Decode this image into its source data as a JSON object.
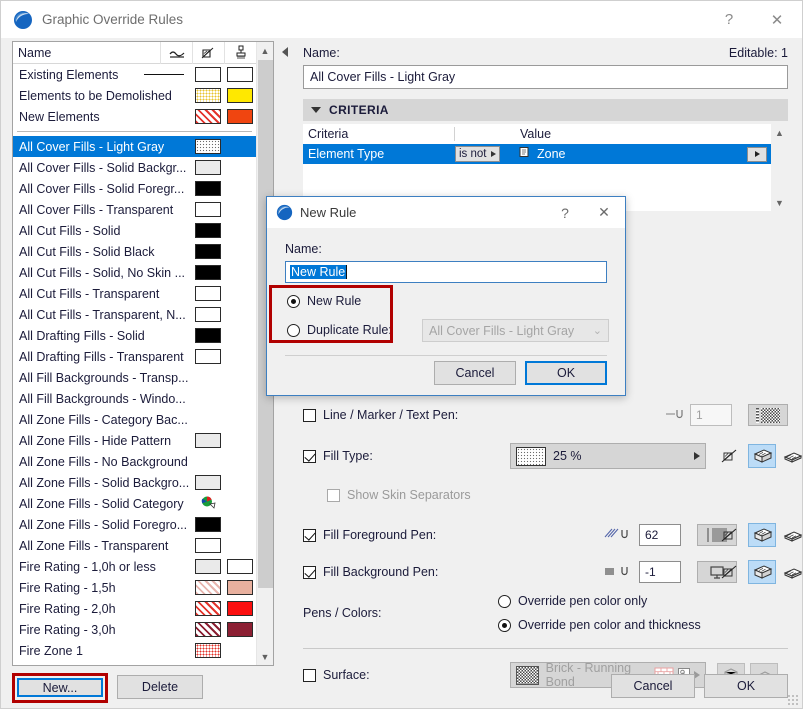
{
  "window": {
    "title": "Graphic Override Rules",
    "help_label": "?",
    "close_label": "✕"
  },
  "left_panel": {
    "columns": {
      "name": "Name",
      "icon_line": "line-style-icon",
      "icon_fill": "fill-override-icon",
      "icon_surface": "surface-brush-icon"
    },
    "top_items": [
      {
        "label": "Existing Elements",
        "swatch_line": true,
        "sw1": "white",
        "sw2": "white"
      },
      {
        "label": "Elements to be Demolished",
        "sw1": "dots-yellow",
        "sw2": "#ffe800"
      },
      {
        "label": "New Elements",
        "sw1": "hatch-red",
        "sw2": "#f04510"
      }
    ],
    "items": [
      {
        "label": "All Cover Fills - Light Gray",
        "selected": true,
        "sw1": "dots-gray"
      },
      {
        "label": "All Cover Fills - Solid Backgr...",
        "sw1": "#eaeaea"
      },
      {
        "label": "All Cover Fills - Solid Foregr...",
        "sw1": "#000000"
      },
      {
        "label": "All Cover Fills - Transparent",
        "sw1": "#ffffff"
      },
      {
        "label": "All Cut Fills - Solid",
        "sw1": "#000000"
      },
      {
        "label": "All Cut Fills - Solid Black",
        "sw1": "#000000"
      },
      {
        "label": "All Cut Fills - Solid, No Skin ...",
        "sw1": "#000000"
      },
      {
        "label": "All Cut Fills - Transparent",
        "sw1": "#ffffff"
      },
      {
        "label": "All Cut Fills - Transparent, N...",
        "sw1": "#ffffff"
      },
      {
        "label": "All Drafting Fills - Solid",
        "sw1": "#000000"
      },
      {
        "label": "All Drafting Fills - Transparent",
        "sw1": "#ffffff"
      },
      {
        "label": "All Fill Backgrounds - Transp...",
        "sw1": "none"
      },
      {
        "label": "All Fill Backgrounds - Windo...",
        "sw1": "none"
      },
      {
        "label": "All Zone Fills - Category Bac...",
        "sw1": "none"
      },
      {
        "label": "All Zone Fills - Hide Pattern",
        "sw1": "#eaeaea"
      },
      {
        "label": "All Zone Fills - No Background",
        "sw1": "none"
      },
      {
        "label": "All Zone Fills - Solid Backgro...",
        "sw1": "#eaeaea"
      },
      {
        "label": "All Zone Fills - Solid Category",
        "sw1": "category-icon"
      },
      {
        "label": "All Zone Fills - Solid Foregro...",
        "sw1": "#000000"
      },
      {
        "label": "All Zone Fills - Transparent",
        "sw1": "#ffffff"
      },
      {
        "label": "Fire Rating - 1,0h or less",
        "sw1": "#eaeaea",
        "sw2": "#ffffff"
      },
      {
        "label": "Fire Rating - 1,5h",
        "sw1": "hatch-pink",
        "sw2": "#e8b09e"
      },
      {
        "label": "Fire Rating - 2,0h",
        "sw1": "hatch-red",
        "sw2": "#fb0f0f"
      },
      {
        "label": "Fire Rating - 3,0h",
        "sw1": "hatch-dark",
        "sw2": "#8c1f33"
      },
      {
        "label": "Fire Zone 1",
        "sw1": "dots-red"
      }
    ],
    "buttons": {
      "new": "New...",
      "delete": "Delete"
    }
  },
  "right_panel": {
    "name_label": "Name:",
    "editable_label": "Editable: 1",
    "name_value": "All Cover Fills - Light Gray",
    "criteria_section": "CRITERIA",
    "criteria_table": {
      "headers": [
        "Criteria",
        "",
        "Value"
      ],
      "rows": [
        {
          "criteria": "Element Type",
          "operator": "is not",
          "value": "Zone"
        }
      ]
    },
    "options": {
      "line_marker_text_pen": {
        "label": "Line / Marker / Text Pen:",
        "checked": false,
        "pen": "1"
      },
      "fill_type": {
        "label": "Fill Type:",
        "checked": true,
        "value": "25 %"
      },
      "show_skin_separators": {
        "label": "Show Skin Separators",
        "checked": false,
        "disabled": true
      },
      "fill_foreground_pen": {
        "label": "Fill Foreground Pen:",
        "checked": true,
        "pen": "62"
      },
      "fill_background_pen": {
        "label": "Fill Background Pen:",
        "checked": true,
        "pen": "-1"
      },
      "pens_colors": {
        "label": "Pens / Colors:",
        "option_color_only": "Override pen color only",
        "option_color_thickness": "Override pen color and thickness",
        "selected": "Override pen color and thickness"
      },
      "surface": {
        "label": "Surface:",
        "checked": false,
        "value": "Brick - Running Bond"
      }
    },
    "buttons": {
      "cancel": "Cancel",
      "ok": "OK"
    }
  },
  "dialog": {
    "title": "New Rule",
    "help_label": "?",
    "close_label": "✕",
    "name_label": "Name:",
    "name_value": "New Rule",
    "radio_new": "New Rule",
    "radio_duplicate": "Duplicate Rule:",
    "selected_radio": "New Rule",
    "duplicate_source": "All Cover Fills - Light Gray",
    "buttons": {
      "cancel": "Cancel",
      "ok": "OK"
    }
  },
  "colors": {
    "accent_blue": "#0078d7",
    "annotation_red": "#b10000",
    "window_bg": "#f0f0f0"
  }
}
